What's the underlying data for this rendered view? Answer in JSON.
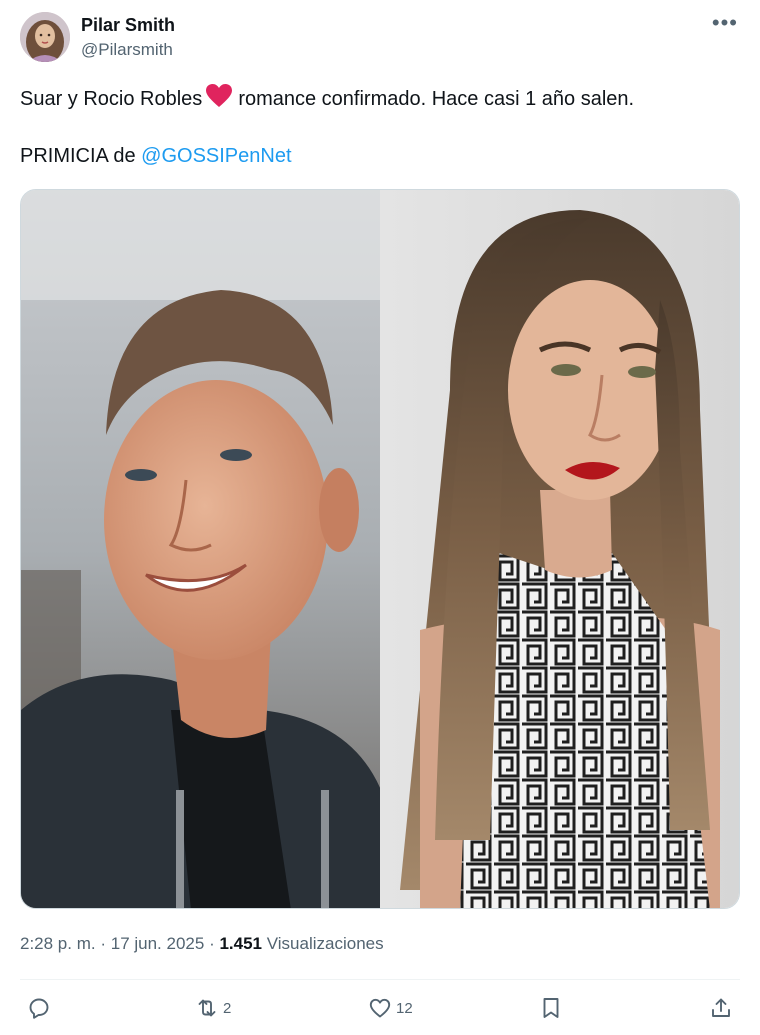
{
  "post": {
    "author_name": "Pilar Smith",
    "author_handle": "@Pilarsmith",
    "text_before_emoji": "Suar y Rocio Robles",
    "text_after_emoji": "romance confirmado. Hace casi 1 año salen.",
    "line2_prefix": "PRIMICIA de ",
    "line2_mention": "@GOSSIPenNet",
    "time": "2:28 p. m.",
    "date": "17 jun. 2025",
    "views_count": "1.451",
    "views_label": "Visualizaciones"
  },
  "actions": {
    "reposts": "2",
    "likes": "12"
  },
  "icons": {
    "more": "more-horizontal-icon",
    "emoji": "red-heart-emoji",
    "reply": "reply-icon",
    "repost": "repost-icon",
    "like": "like-icon",
    "bookmark": "bookmark-icon",
    "share": "share-icon"
  },
  "colors": {
    "link": "#1d9bf0",
    "secondary_text": "#536471",
    "primary_text": "#0f1419",
    "heart": "#e0245e"
  }
}
